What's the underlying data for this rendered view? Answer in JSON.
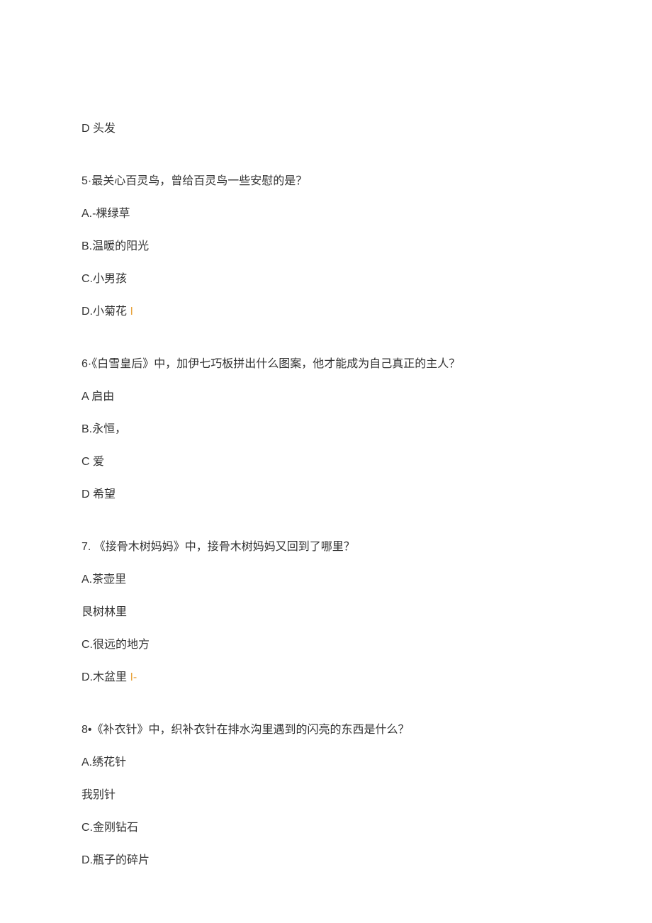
{
  "block1": {
    "line1": "D 头发"
  },
  "q5": {
    "question": "5·最关心百灵鸟，曾给百灵鸟一些安慰的是？",
    "optA": "A.-棵绿草",
    "optB": "B.温暖的阳光",
    "optC": "C.小男孩",
    "optD_prefix": "D.小菊花 ",
    "optD_suffix": "I"
  },
  "q6": {
    "question": "6·《白雪皇后》中，加伊七巧板拼出什么图案，他才能成为自己真正的主人？",
    "optA": "A 启由",
    "optB": "B.永恒，",
    "optC": "C 爱",
    "optD": "D 希望"
  },
  "q7": {
    "question": "7.  《接骨木树妈妈》中，接骨木树妈妈又回到了哪里？",
    "optA": "A.茶壶里",
    "optB": "艮树林里",
    "optC": "C.很远的地方",
    "optD_prefix": "D.木盆里 ",
    "optD_suffix": "I-"
  },
  "q8": {
    "question": "8•《补衣针》中，织补衣针在排水沟里遇到的闪亮的东西是什么？",
    "optA": "A.绣花针",
    "optB": "我别针",
    "optC": "C.金刚钻石",
    "optD": "D.瓶子的碎片"
  }
}
